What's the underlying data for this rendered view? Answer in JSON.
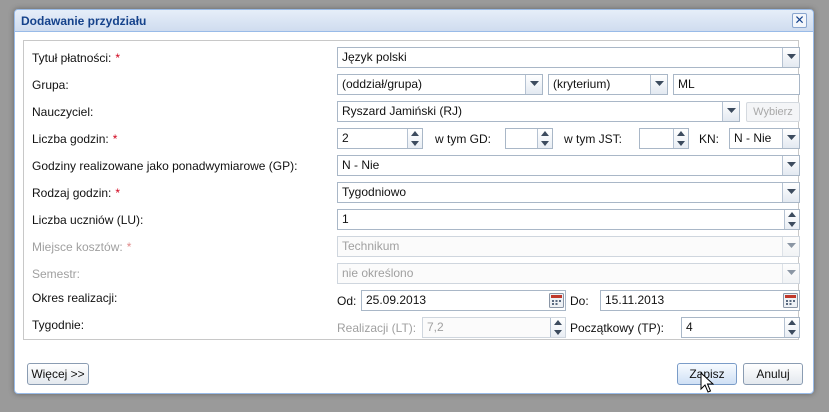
{
  "dialog": {
    "title": "Dodawanie przydziału",
    "close_glyph": "✕"
  },
  "form": {
    "required_mark": "*",
    "tytul": {
      "label": "Tytuł płatności:",
      "value": "Język polski"
    },
    "grupa": {
      "label": "Grupa:",
      "oddzial": "(oddział/grupa)",
      "kryterium": "(kryterium)",
      "text": "ML"
    },
    "nauczyciel": {
      "label": "Nauczyciel:",
      "value": "Ryszard Jamiński (RJ)",
      "button": "Wybierz"
    },
    "liczba_godzin": {
      "label": "Liczba godzin:",
      "value": "2",
      "gd_label": "w tym GD:",
      "gd_value": "",
      "jst_label": "w tym JST:",
      "jst_value": "",
      "kn_label": "KN:",
      "kn_value": "N - Nie"
    },
    "gp": {
      "label": "Godziny realizowane jako ponadwymiarowe (GP):",
      "value": "N - Nie"
    },
    "rodzaj": {
      "label": "Rodzaj godzin:",
      "value": "Tygodniowo"
    },
    "uczniowie": {
      "label": "Liczba uczniów (LU):",
      "value": "1"
    },
    "miejsce": {
      "label": "Miejsce kosztów:",
      "value": "Technikum"
    },
    "semestr": {
      "label": "Semestr:",
      "value": "nie określono"
    },
    "okres": {
      "label": "Okres realizacji:",
      "od_label": "Od:",
      "od_value": "25.09.2013",
      "do_label": "Do:",
      "do_value": "15.11.2013"
    },
    "tygodnie": {
      "label": "Tygodnie:",
      "lt_label": "Realizacji (LT):",
      "lt_value": "7,2",
      "tp_label": "Początkowy (TP):",
      "tp_value": "4"
    }
  },
  "footer": {
    "more": "Więcej >>",
    "save": "Zapisz",
    "cancel": "Anuluj"
  },
  "colors": {
    "title": "#15428b",
    "required": "#d0021b",
    "border": "#99bbe8"
  }
}
